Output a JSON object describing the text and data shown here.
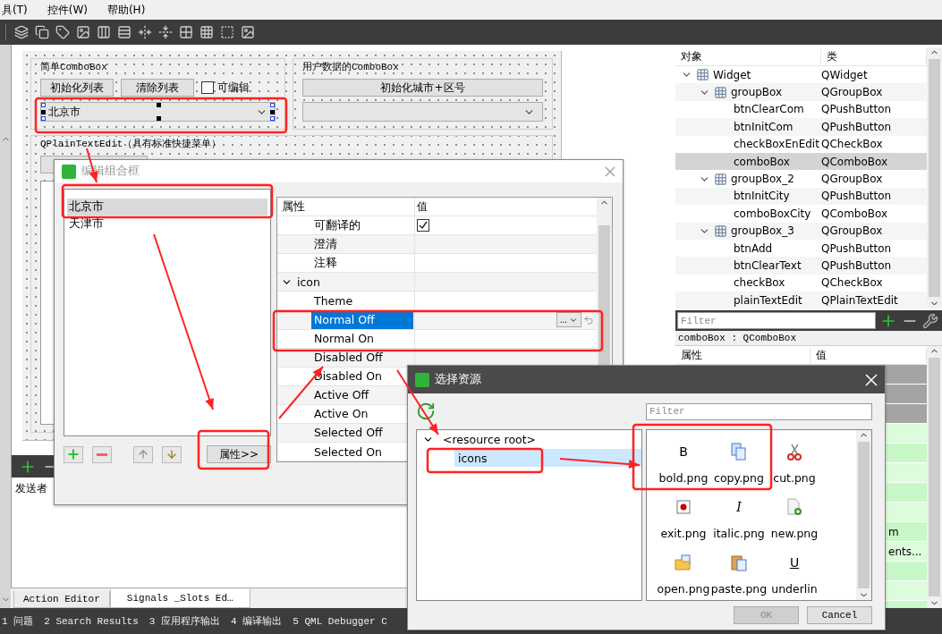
{
  "menu": [
    {
      "label": "具(T)"
    },
    {
      "label": "控件(W)"
    },
    {
      "label": "帮助(H)"
    }
  ],
  "form": {
    "group_1": {
      "title": "简单ComboBox",
      "buttons": [
        "初始化列表",
        "清除列表"
      ],
      "checkbox": {
        "label": "可编辑",
        "checked": false
      },
      "combo": {
        "value": "北京市"
      }
    },
    "group_2": {
      "title": "用户数据的ComboBox",
      "button": "初始化城市+区号"
    },
    "group_3": {
      "title": "QPlainTextEdit（具有标准快捷菜单）"
    }
  },
  "signal_editor": {
    "column_1": "发送者"
  },
  "editor_tabs": [
    {
      "label": "Action Editor",
      "selected": false
    },
    {
      "label": "Signals _Slots Ed…",
      "selected": true
    }
  ],
  "output_tabs": [
    "1 问题",
    "2 Search Results",
    "3 应用程序输出",
    "4 编译输出",
    "5 QML Debugger C"
  ],
  "object_inspector": {
    "columns": [
      "对象",
      "类"
    ],
    "tree": [
      {
        "name": "Widget",
        "class": "QWidget",
        "expanded": true,
        "selected": false,
        "children": [
          {
            "name": "groupBox",
            "class": "QGroupBox",
            "expanded": true,
            "selected": false,
            "children": [
              {
                "name": "btnClearCom",
                "class": "QPushButton",
                "selected": false
              },
              {
                "name": "btnInitCom",
                "class": "QPushButton",
                "selected": false
              },
              {
                "name": "checkBoxEnEdit",
                "class": "QCheckBox",
                "selected": false
              },
              {
                "name": "comboBox",
                "class": "QComboBox",
                "selected": true
              }
            ]
          },
          {
            "name": "groupBox_2",
            "class": "QGroupBox",
            "expanded": true,
            "selected": false,
            "children": [
              {
                "name": "btnInitCity",
                "class": "QPushButton",
                "selected": false
              },
              {
                "name": "comboBoxCity",
                "class": "QComboBox",
                "selected": false
              }
            ]
          },
          {
            "name": "groupBox_3",
            "class": "QGroupBox",
            "expanded": true,
            "selected": false,
            "children": [
              {
                "name": "btnAdd",
                "class": "QPushButton",
                "selected": false
              },
              {
                "name": "btnClearText",
                "class": "QPushButton",
                "selected": false
              },
              {
                "name": "checkBox",
                "class": "QCheckBox",
                "selected": false
              },
              {
                "name": "plainTextEdit",
                "class": "QPlainTextEdit",
                "selected": false
              }
            ]
          }
        ]
      }
    ],
    "filter": {
      "placeholder": "Filter"
    },
    "current": "comboBox : QComboBox"
  },
  "property_editor": {
    "columns": [
      "属性",
      "值"
    ],
    "rows": [
      {
        "kind": "group"
      },
      {
        "kind": "group"
      },
      {
        "kind": "group"
      },
      {
        "kind": "prop"
      },
      {
        "kind": "prop"
      },
      {
        "kind": "prop"
      },
      {
        "kind": "prop"
      },
      {
        "kind": "prop"
      },
      {
        "kind": "prop",
        "value": "m"
      },
      {
        "kind": "prop",
        "value": "ents..."
      },
      {
        "kind": "prop"
      },
      {
        "kind": "prop"
      },
      {
        "kind": "prop"
      }
    ]
  },
  "combo_dialog": {
    "title": "编辑组合框",
    "items": [
      {
        "label": "北京市",
        "selected": true
      },
      {
        "label": "天津市",
        "selected": false
      }
    ],
    "properties_button": "属性>>",
    "table": {
      "columns": [
        "属性",
        "值"
      ],
      "browse_label": "...",
      "rows": [
        {
          "kind": "bool",
          "name": "可翻译的",
          "checked": true,
          "selected": false
        },
        {
          "kind": "text",
          "name": "澄清",
          "selected": false
        },
        {
          "kind": "text",
          "name": "注释",
          "selected": false
        },
        {
          "kind": "group",
          "name": "icon",
          "expanded": true,
          "selected": false
        },
        {
          "kind": "text",
          "name": "Theme",
          "selected": false
        },
        {
          "kind": "text",
          "name": "Normal Off",
          "selected": true
        },
        {
          "kind": "text",
          "name": "Normal On",
          "selected": false
        },
        {
          "kind": "text",
          "name": "Disabled Off",
          "selected": false
        },
        {
          "kind": "text",
          "name": "Disabled On",
          "selected": false
        },
        {
          "kind": "text",
          "name": "Active Off",
          "selected": false
        },
        {
          "kind": "text",
          "name": "Active On",
          "selected": false
        },
        {
          "kind": "text",
          "name": "Selected Off",
          "selected": false
        },
        {
          "kind": "text",
          "name": "Selected On",
          "selected": false
        }
      ]
    }
  },
  "resource_dialog": {
    "title": "选择资源",
    "filter": {
      "placeholder": "Filter"
    },
    "tree": [
      {
        "label": "<resource root>",
        "expanded": true,
        "selected": false,
        "children": [
          {
            "label": "icons",
            "selected": true
          }
        ]
      }
    ],
    "files": [
      {
        "name": "bold.png",
        "kind": "glyph",
        "glyph": "B"
      },
      {
        "name": "copy.png",
        "kind": "copy"
      },
      {
        "name": "cut.png",
        "kind": "cut"
      },
      {
        "name": "exit.png",
        "kind": "exit"
      },
      {
        "name": "italic.png",
        "kind": "glyph",
        "glyph": "I"
      },
      {
        "name": "new.png",
        "kind": "new"
      },
      {
        "name": "open.png",
        "kind": "open"
      },
      {
        "name": "paste.png",
        "kind": "paste"
      },
      {
        "name": "underlin",
        "kind": "glyph",
        "glyph": "U"
      }
    ],
    "buttons": [
      {
        "label": "OK",
        "disabled": true
      },
      {
        "label": "Cancel",
        "disabled": false
      }
    ]
  }
}
